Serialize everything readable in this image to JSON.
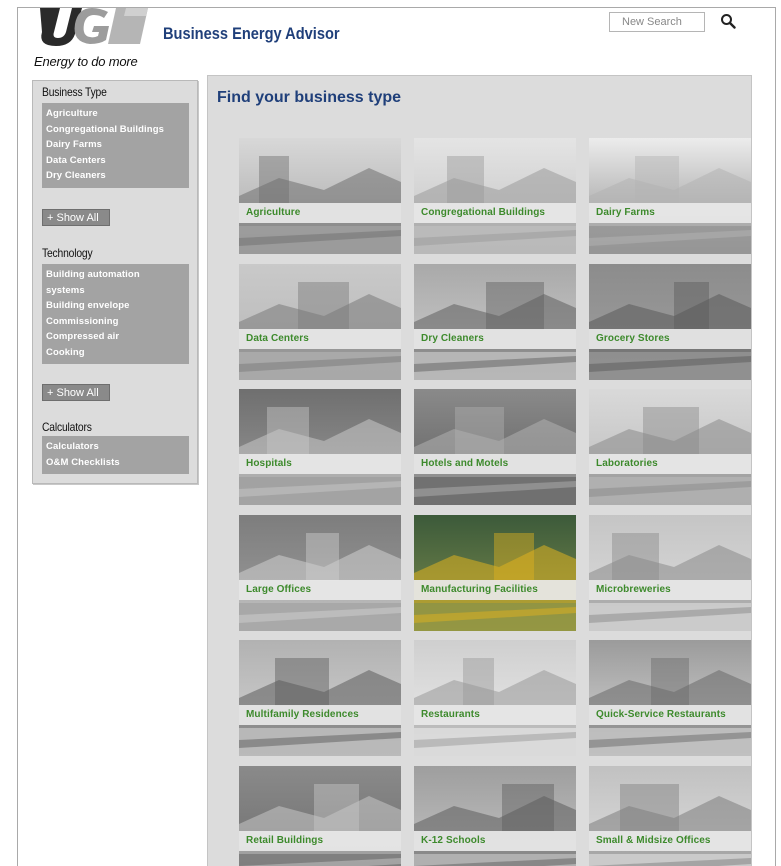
{
  "header": {
    "logo_text": "UGI",
    "tagline": "Energy to do more",
    "site_title": "Business Energy Advisor",
    "search_placeholder": "New Search",
    "search_icon": "search-icon"
  },
  "sidebar": {
    "business_type": {
      "heading": "Business Type",
      "items": [
        "Agriculture",
        "Congregational Buildings",
        "Dairy Farms",
        "Data Centers",
        "Dry Cleaners"
      ],
      "show_all": "+ Show All"
    },
    "technology": {
      "heading": "Technology",
      "items": [
        "Building automation",
        "systems",
        "Building envelope",
        "Commissioning",
        "Compressed air",
        "Cooking"
      ],
      "show_all": "+ Show All"
    },
    "calculators": {
      "heading": "Calculators",
      "items": [
        "Calculators",
        "O&M Checklists"
      ]
    }
  },
  "main": {
    "title": "Find your business type",
    "tiles": [
      {
        "label": "Agriculture"
      },
      {
        "label": "Congregational Buildings"
      },
      {
        "label": "Dairy Farms"
      },
      {
        "label": "Data Centers"
      },
      {
        "label": "Dry Cleaners"
      },
      {
        "label": "Grocery Stores"
      },
      {
        "label": "Hospitals"
      },
      {
        "label": "Hotels and Motels"
      },
      {
        "label": "Laboratories"
      },
      {
        "label": "Large Offices"
      },
      {
        "label": "Manufacturing Facilities"
      },
      {
        "label": "Microbreweries"
      },
      {
        "label": "Multifamily Residences"
      },
      {
        "label": "Restaurants"
      },
      {
        "label": "Quick-Service Restaurants"
      },
      {
        "label": "Retail Buildings"
      },
      {
        "label": "K-12 Schools"
      },
      {
        "label": "Small & Midsize Offices"
      }
    ]
  },
  "colors": {
    "title_blue": "#1f3f7a",
    "tile_label_green": "#3d8a2c",
    "sidebar_bg": "#dcdcdc",
    "sidebar_list_bg": "#a3a3a3"
  }
}
